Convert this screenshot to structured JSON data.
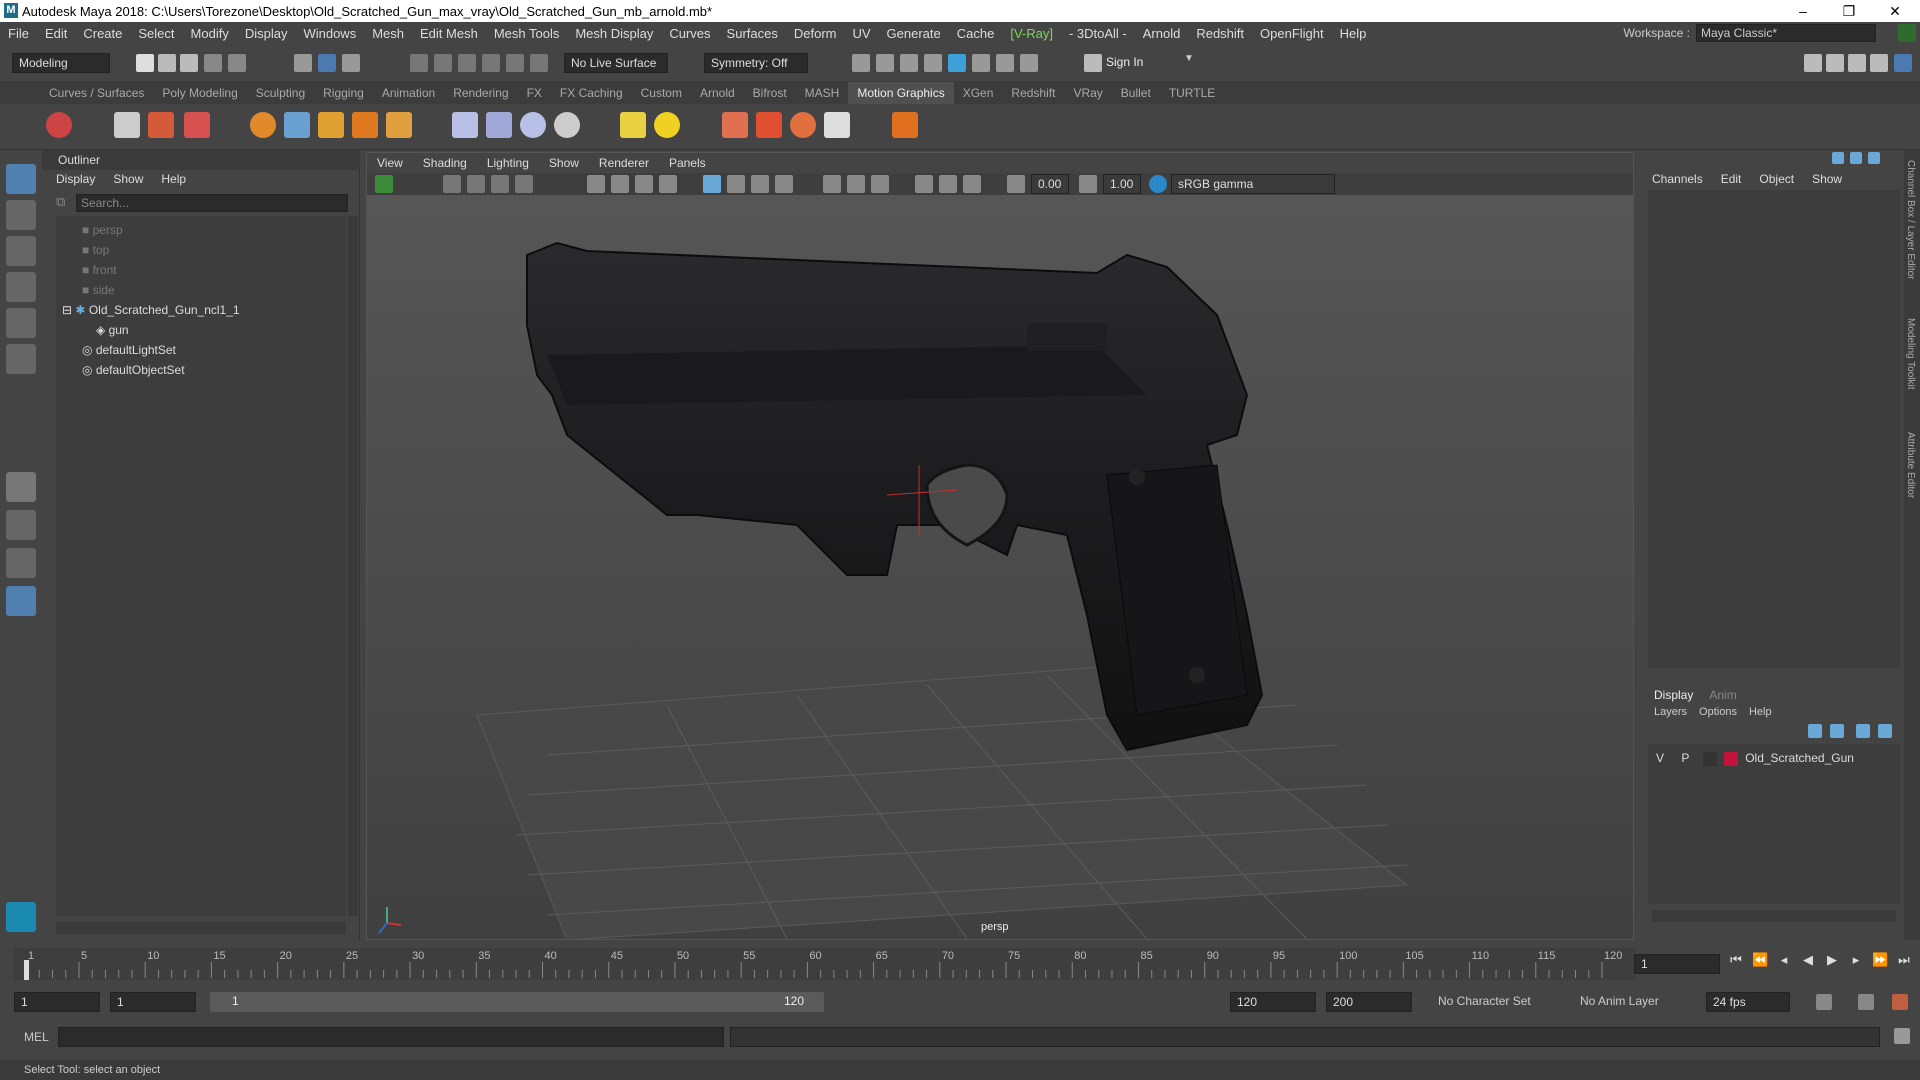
{
  "window": {
    "title": "Autodesk Maya 2018: C:\\Users\\Torezone\\Desktop\\Old_Scratched_Gun_max_vray\\Old_Scratched_Gun_mb_arnold.mb*",
    "minimize": "–",
    "maximize": "❐",
    "close": "✕"
  },
  "menubar": {
    "items": [
      "File",
      "Edit",
      "Create",
      "Select",
      "Modify",
      "Display",
      "Windows",
      "Mesh",
      "Edit Mesh",
      "Mesh Tools",
      "Mesh Display",
      "Curves",
      "Surfaces",
      "Deform",
      "UV",
      "Generate",
      "Cache",
      "[V-Ray]",
      "- 3DtoAll -",
      "Arnold",
      "Redshift",
      "OpenFlight",
      "Help"
    ],
    "workspace_label": "Workspace :",
    "workspace_value": "Maya Classic*"
  },
  "statusline": {
    "mode": "Modeling",
    "live_surface": "No Live Surface",
    "symmetry": "Symmetry: Off",
    "sign_in": "Sign In"
  },
  "shelf_tabs": [
    "Curves / Surfaces",
    "Poly Modeling",
    "Sculpting",
    "Rigging",
    "Animation",
    "Rendering",
    "FX",
    "FX Caching",
    "Custom",
    "Arnold",
    "Bifrost",
    "MASH",
    "Motion Graphics",
    "XGen",
    "Redshift",
    "VRay",
    "Bullet",
    "TURTLE"
  ],
  "shelf_active": "Motion Graphics",
  "outliner": {
    "title": "Outliner",
    "menus": [
      "Display",
      "Show",
      "Help"
    ],
    "search_placeholder": "Search...",
    "items": [
      {
        "label": "persp",
        "kind": "camera",
        "dim": true
      },
      {
        "label": "top",
        "kind": "camera",
        "dim": true
      },
      {
        "label": "front",
        "kind": "camera",
        "dim": true
      },
      {
        "label": "side",
        "kind": "camera",
        "dim": true
      },
      {
        "label": "Old_Scratched_Gun_ncl1_1",
        "kind": "group",
        "dim": false
      },
      {
        "label": "gun",
        "kind": "mesh",
        "dim": false
      },
      {
        "label": "defaultLightSet",
        "kind": "set",
        "dim": false
      },
      {
        "label": "defaultObjectSet",
        "kind": "set",
        "dim": false
      }
    ]
  },
  "viewport": {
    "menus": [
      "View",
      "Shading",
      "Lighting",
      "Show",
      "Renderer",
      "Panels"
    ],
    "exposure": "0.00",
    "gamma": "1.00",
    "color_space": "sRGB gamma",
    "camera": "persp"
  },
  "channelbox": {
    "menus": [
      "Channels",
      "Edit",
      "Object",
      "Show"
    ],
    "side_tabs": [
      "Channel Box / Layer Editor",
      "Modeling Toolkit",
      "Attribute Editor"
    ]
  },
  "layers": {
    "tabs": [
      "Display",
      "Anim"
    ],
    "menus": [
      "Layers",
      "Options",
      "Help"
    ],
    "row": {
      "v": "V",
      "p": "P",
      "name": "Old_Scratched_Gun",
      "color": "#c0143c"
    }
  },
  "timeline": {
    "ticks": [
      "1",
      "5",
      "10",
      "15",
      "20",
      "25",
      "30",
      "35",
      "40",
      "45",
      "50",
      "55",
      "60",
      "65",
      "70",
      "75",
      "80",
      "85",
      "90",
      "95",
      "100",
      "105",
      "110",
      "115",
      "120"
    ],
    "current": "1"
  },
  "range": {
    "start": "1",
    "playback_start": "1",
    "slider_start": "1",
    "slider_end": "120",
    "playback_end": "120",
    "end": "200",
    "character_set": "No Character Set",
    "anim_layer": "No Anim Layer",
    "fps": "24 fps"
  },
  "cmdline": {
    "lang": "MEL"
  },
  "helpline": {
    "text": "Select Tool: select an object"
  }
}
